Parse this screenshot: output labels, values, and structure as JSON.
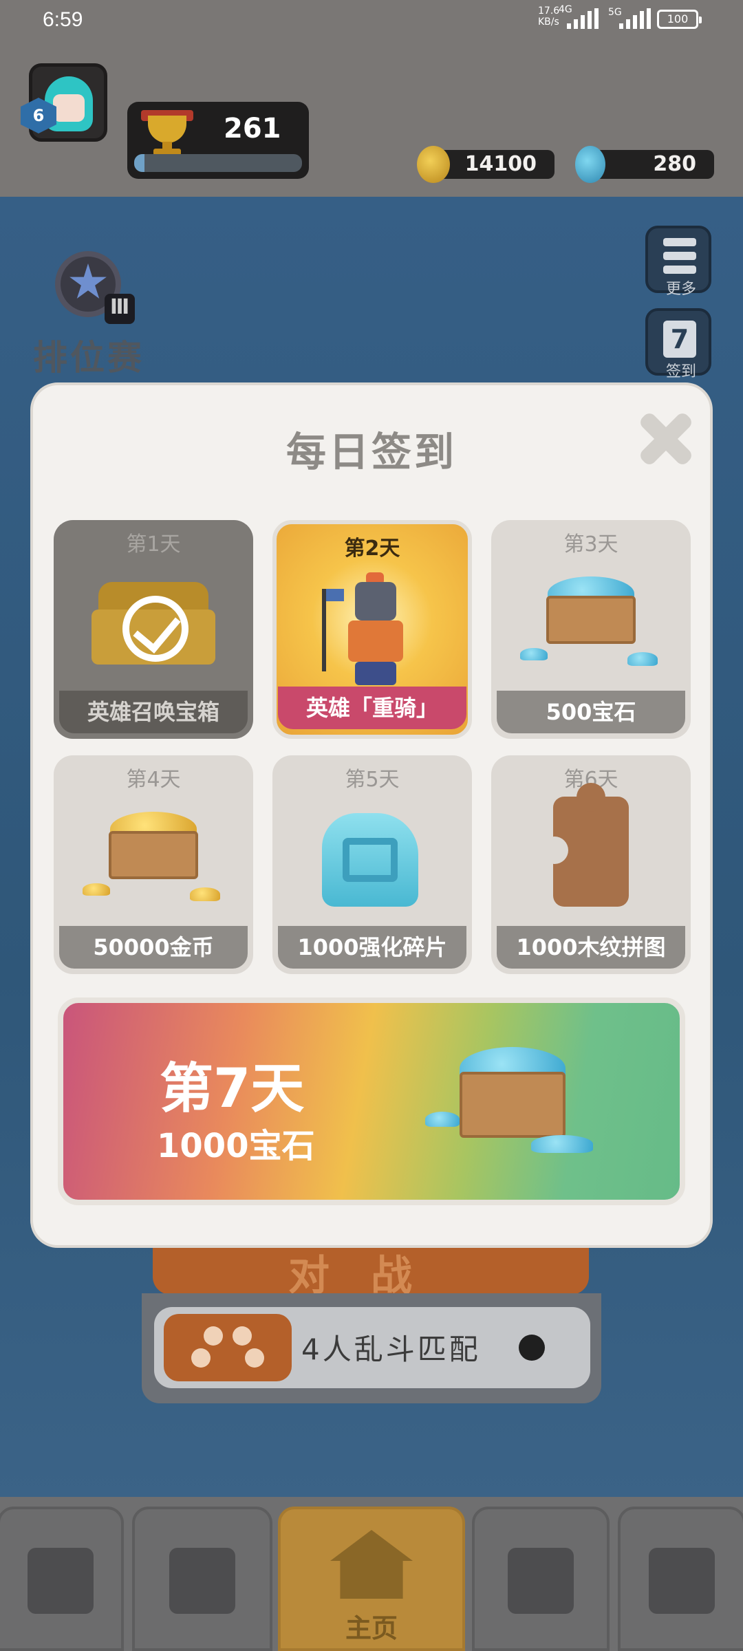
{
  "status_bar": {
    "time": "6:59",
    "net_speed": "17.6",
    "net_unit": "KB/s",
    "net_type_1": "4G",
    "net_type_2": "5G",
    "battery": "100"
  },
  "hud": {
    "player_level": "6",
    "trophies": "261",
    "trophy_progress": 0.06,
    "coins": "14100",
    "gems": "280"
  },
  "lobby": {
    "rank_label": "排位赛",
    "more_label": "更多",
    "checkin_label": "签到",
    "checkin_day_icon": "7",
    "battle_label": "对战",
    "match_label": "4人乱斗匹配",
    "nav_home_label": "主页"
  },
  "modal": {
    "title": "每日签到",
    "days": [
      {
        "day": "第1天",
        "reward": "英雄召唤宝箱",
        "state": "claimed"
      },
      {
        "day": "第2天",
        "reward": "英雄「重骑」",
        "state": "today"
      },
      {
        "day": "第3天",
        "reward": "500宝石",
        "state": "locked"
      },
      {
        "day": "第4天",
        "reward": "50000金币",
        "state": "locked"
      },
      {
        "day": "第5天",
        "reward": "1000强化碎片",
        "state": "locked"
      },
      {
        "day": "第6天",
        "reward": "1000木纹拼图",
        "state": "locked"
      }
    ],
    "day7": {
      "day": "第7天",
      "reward": "1000宝石"
    }
  },
  "colors": {
    "today_label": "#c9496b",
    "accent_orange": "#b4602a",
    "board_blue": "#365f86"
  }
}
